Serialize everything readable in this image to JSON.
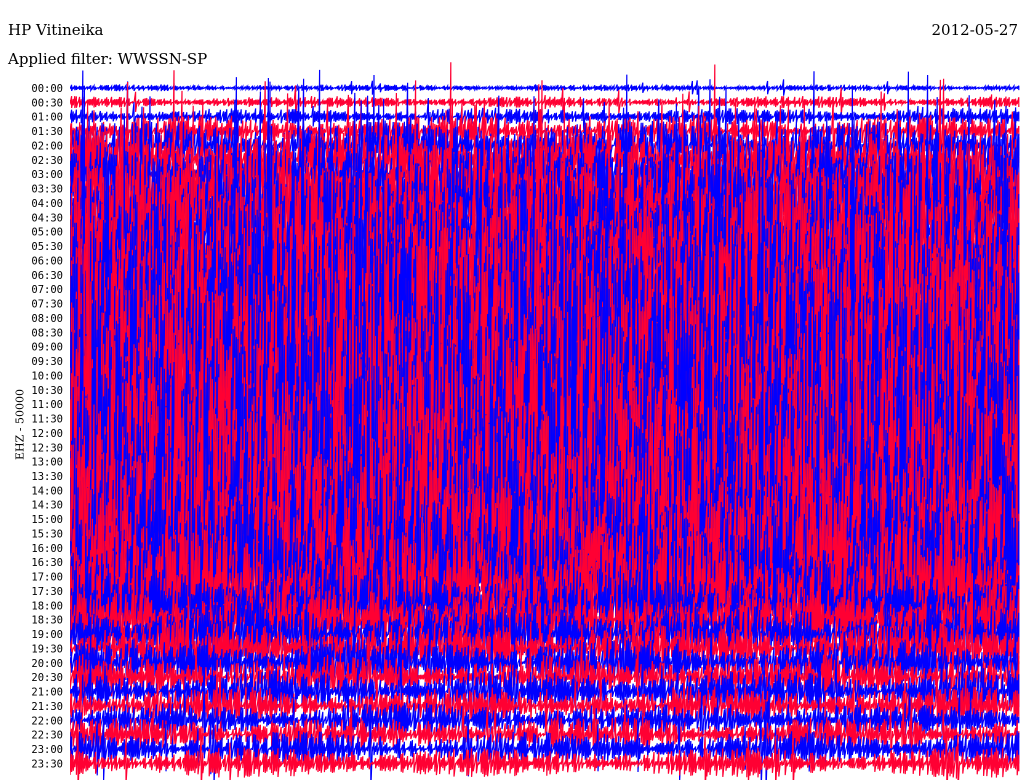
{
  "header": {
    "station": "HP Vitineika",
    "filter": "Applied filter: WWSSN-SP",
    "date": "2012-05-27"
  },
  "chart_data": {
    "type": "helicorder",
    "channel_label": "EHZ - 50000",
    "time_labels": [
      "00:00",
      "00:30",
      "01:00",
      "01:30",
      "02:00",
      "02:30",
      "03:00",
      "03:30",
      "04:00",
      "04:30",
      "05:00",
      "05:30",
      "06:00",
      "06:30",
      "07:00",
      "07:30",
      "08:00",
      "08:30",
      "09:00",
      "09:30",
      "10:00",
      "10:30",
      "11:00",
      "11:30",
      "12:00",
      "12:30",
      "13:00",
      "13:30",
      "14:00",
      "14:30",
      "15:00",
      "15:30",
      "16:00",
      "16:30",
      "17:00",
      "17:30",
      "18:00",
      "18:30",
      "19:00",
      "19:30",
      "20:00",
      "20:30",
      "21:00",
      "21:30",
      "22:00",
      "22:30",
      "23:00",
      "23:30"
    ],
    "trace_colors": [
      "#0000ff",
      "#ff0033"
    ],
    "background": "#ffffff",
    "note_levels": [
      0.2,
      0.35,
      0.5,
      0.9,
      1.4,
      1.8,
      2.2,
      2.6,
      3.0,
      3.2,
      3.4,
      3.5,
      3.6,
      3.8,
      4.2,
      4.6,
      5.0,
      5.2,
      5.4,
      5.6,
      5.8,
      6.0,
      6.2,
      6.2,
      6.3,
      6.3,
      6.2,
      6.0,
      5.8,
      5.6,
      5.4,
      5.2,
      5.0,
      4.8,
      4.4,
      3.6,
      2.4,
      2.0,
      1.8,
      1.6,
      1.4,
      1.3,
      1.2,
      1.1,
      1.0,
      1.0,
      1.0,
      0.9
    ]
  }
}
